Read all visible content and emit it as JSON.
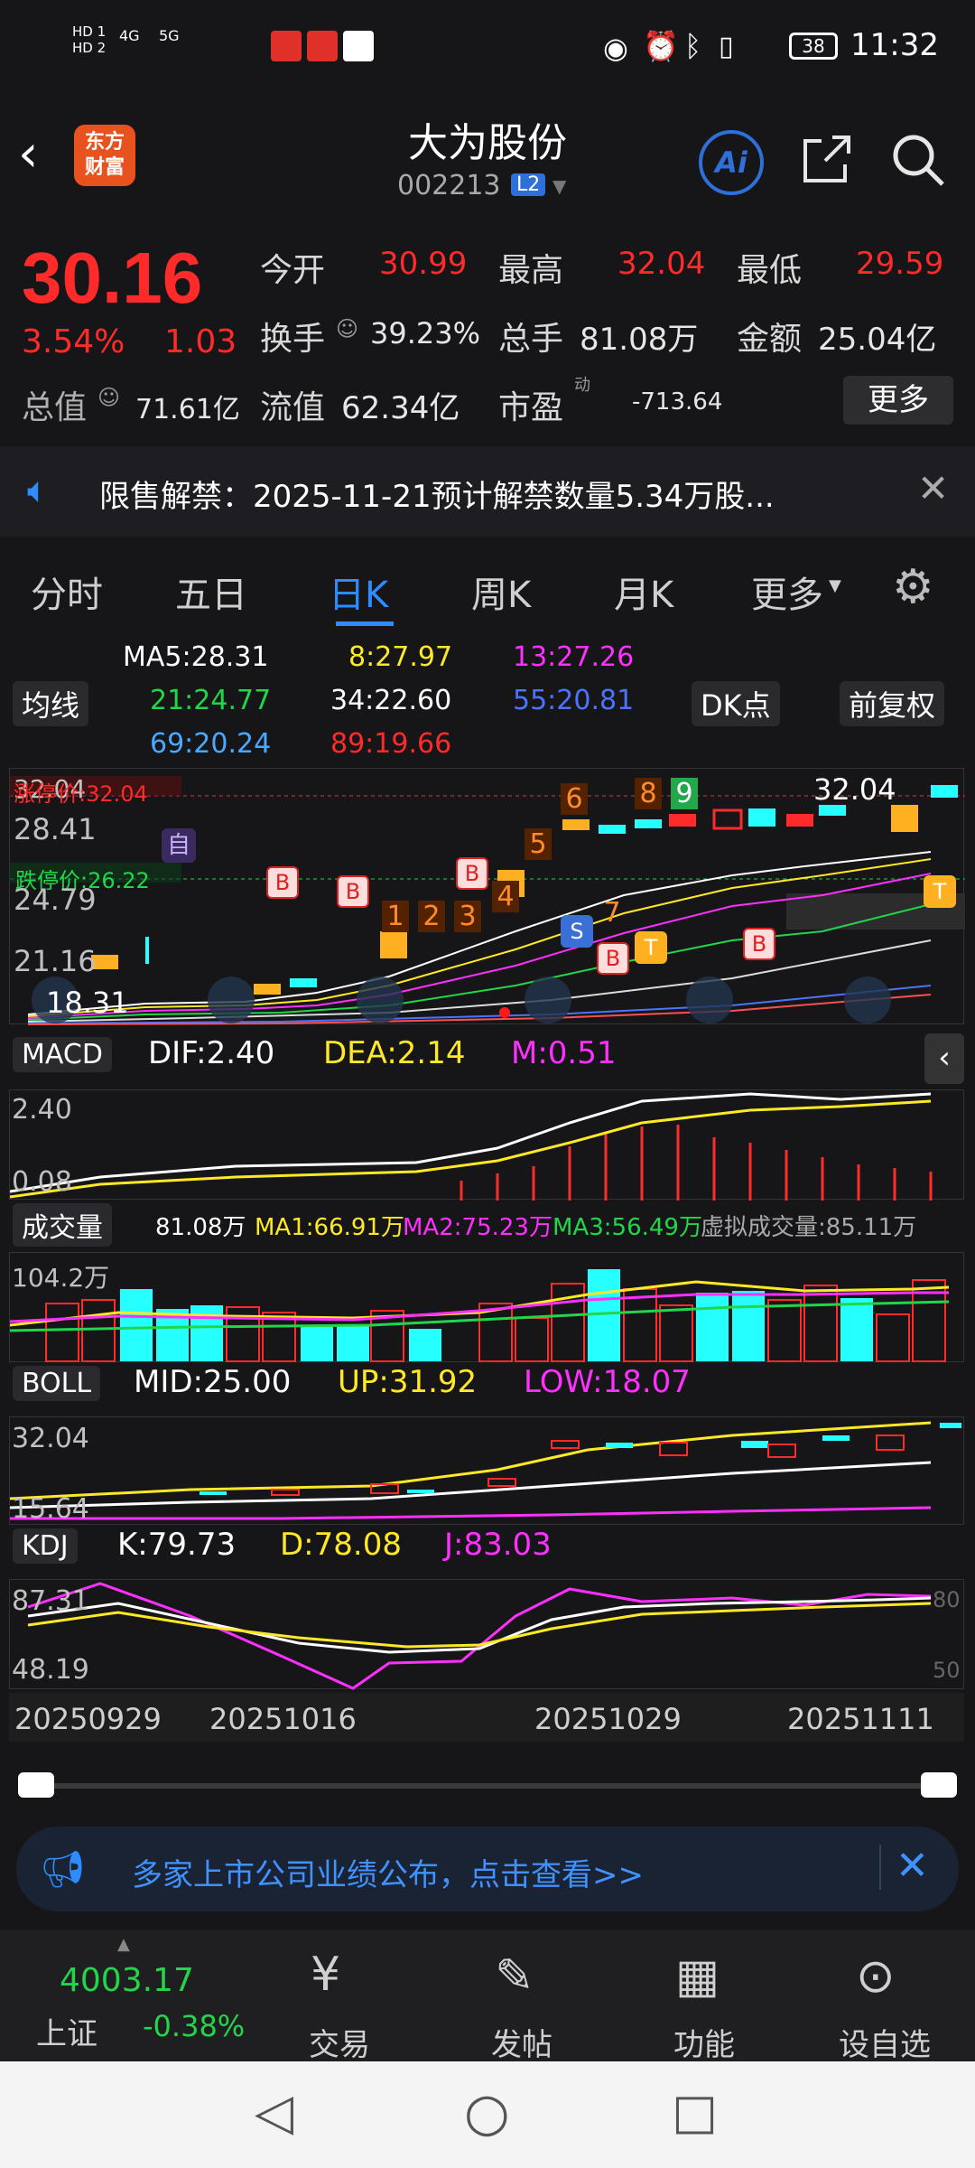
{
  "status": {
    "time": "11:32",
    "battery": "38",
    "sim1": "HD 1",
    "sim2": "HD 2",
    "net1": "4G",
    "net2": "5G"
  },
  "header": {
    "title": "大为股份",
    "code": "002213",
    "badge": "L2",
    "logo_line1": "东方",
    "logo_line2": "财富",
    "ai_label": "Ai"
  },
  "quote": {
    "price": "30.16",
    "pct": "3.54%",
    "chg": "1.03",
    "open_label": "今开",
    "open": "30.99",
    "high_label": "最高",
    "high": "32.04",
    "low_label": "最低",
    "low": "29.59",
    "turnover_label": "换手",
    "turnover": "39.23%",
    "volume_label": "总手",
    "volume": "81.08万",
    "amount_label": "金额",
    "amount": "25.04亿",
    "mcap_label": "总值",
    "mcap": "71.61亿",
    "float_label": "流值",
    "float": "62.34亿",
    "pe_label": "市盈",
    "pe_sup": "动",
    "pe": "-713.64",
    "more": "更多"
  },
  "notice": {
    "text": "限售解禁：2025-11-21预计解禁数量5.34万股..."
  },
  "tabs": [
    "分时",
    "五日",
    "日K",
    "周K",
    "月K",
    "更多"
  ],
  "active_tab": "日K",
  "ma": {
    "ma5": "MA5:28.31",
    "ma8": "8:27.97",
    "ma13": "13:27.26",
    "ma21": "21:24.77",
    "ma34": "34:22.60",
    "ma55": "55:20.81",
    "ma69": "69:20.24",
    "ma89": "89:19.66",
    "select": "均线",
    "dk": "DK点",
    "fq": "前复权"
  },
  "kline": {
    "y_labels": [
      "32.04",
      "28.41",
      "24.79",
      "21.16",
      "18.31"
    ],
    "limit_up": "涨停价:32.04",
    "limit_down": "跌停价:26.22",
    "high_mark": "32.04",
    "low_mark": "18.31",
    "signals": [
      "1",
      "2",
      "3",
      "4",
      "5",
      "6",
      "7",
      "8",
      "9"
    ]
  },
  "macd": {
    "label": "MACD",
    "dif": "DIF:2.40",
    "dea": "DEA:2.14",
    "m": "M:0.51",
    "y_top": "2.40",
    "y_bot": "0.08"
  },
  "vol": {
    "label": "成交量",
    "v": "81.08万",
    "ma1": "MA1:66.91万",
    "ma2": "MA2:75.23万",
    "ma3": "MA3:56.49万",
    "virtual": "虚拟成交量:85.11万",
    "y_top": "104.2万"
  },
  "boll": {
    "label": "BOLL",
    "mid": "MID:25.00",
    "up": "UP:31.92",
    "low": "LOW:18.07",
    "y_top": "32.04",
    "y_bot": "15.64"
  },
  "kdj": {
    "label": "KDJ",
    "k": "K:79.73",
    "d": "D:78.08",
    "j": "J:83.03",
    "y_top": "87.31",
    "y_bot": "48.19",
    "r_top": "80",
    "r_bot": "50"
  },
  "dates": [
    "20250929",
    "20251016",
    "20251029",
    "20251111"
  ],
  "banner": {
    "text": "多家上市公司业绩公布，点击查看>>"
  },
  "nav": {
    "index_value": "4003.17",
    "index_name": "上证",
    "index_pct": "-0.38%",
    "items": [
      "交易",
      "发帖",
      "功能",
      "设自选"
    ]
  },
  "colors": {
    "up": "#ff2a2a",
    "down": "#22d64a",
    "accent": "#2f6fd8"
  }
}
